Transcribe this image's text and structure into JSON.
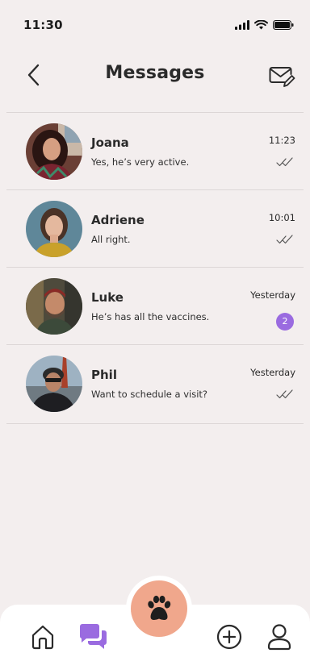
{
  "status_bar": {
    "time": "11:30"
  },
  "header": {
    "title": "Messages"
  },
  "conversations": [
    {
      "name": "Joana",
      "message": "Yes, he’s very active.",
      "time": "11:23",
      "status": "read"
    },
    {
      "name": "Adriene",
      "message": "All right.",
      "time": "10:01",
      "status": "read"
    },
    {
      "name": "Luke",
      "message": "He’s has all the vaccines.",
      "time": "Yesterday",
      "unread": "2"
    },
    {
      "name": "Phil",
      "message": "Want to schedule a visit?",
      "time": "Yesterday",
      "status": "read"
    }
  ],
  "tab_bar": {
    "tabs": [
      "home-icon",
      "chat-icon",
      "paw-icon",
      "add-icon",
      "profile-icon"
    ],
    "active": "chat-icon"
  },
  "colors": {
    "background": "#f3eeee",
    "accent": "#9a6be0",
    "fab": "#f0a78c"
  }
}
